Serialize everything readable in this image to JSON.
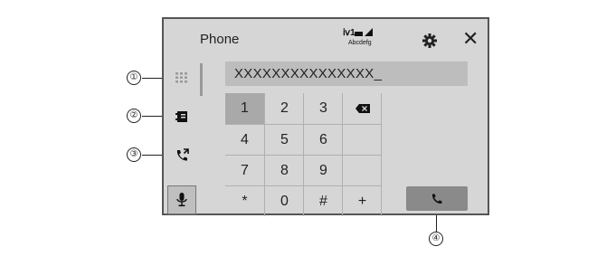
{
  "header": {
    "title": "Phone",
    "status": {
      "bt_label": "ⅳ1",
      "carrier": "Abcdefg"
    },
    "settings_icon": "gear-icon",
    "close_icon": "close-icon",
    "close_glyph": "✕"
  },
  "sidebar": {
    "items": [
      {
        "name": "keypad",
        "icon": "dialpad-icon"
      },
      {
        "name": "contacts",
        "icon": "phonebook-icon"
      },
      {
        "name": "recent-calls",
        "icon": "call-history-icon"
      },
      {
        "name": "voice",
        "icon": "microphone-icon"
      }
    ]
  },
  "dialer": {
    "number": "XXXXXXXXXXXXXXX_",
    "keys": [
      "1",
      "2",
      "3",
      "4",
      "5",
      "6",
      "7",
      "8",
      "9",
      "*",
      "0",
      "#",
      "+"
    ],
    "backspace_icon": "backspace-icon",
    "call_icon": "phone-handset-icon"
  },
  "callouts": [
    "①",
    "②",
    "③",
    "④"
  ],
  "colors": {
    "screen_bg": "#d6d6d6",
    "field_bg": "#bdbdbd",
    "call_button": "#8a8a8a"
  }
}
